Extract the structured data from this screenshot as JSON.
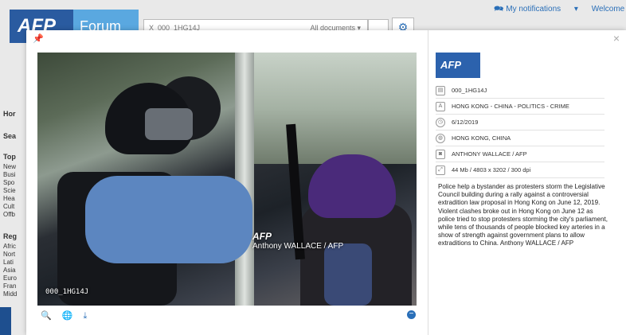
{
  "background": {
    "notifications": "My notifications",
    "welcome": "Welcome",
    "logo_text": "AFP",
    "forum_text": "Forum",
    "search_value": "X_000_1HG14J",
    "search_scope": "All documents",
    "sidebar": {
      "items_top": [
        "Hor",
        "Sea"
      ],
      "topics_header": "Top",
      "topics": [
        "New",
        "Busi",
        "Spo",
        "Scie",
        "Hea",
        "Cult",
        "Offb"
      ],
      "regions_header": "Reg",
      "regions": [
        "Afric",
        "Nort",
        "Lati",
        "Asia",
        "Euro",
        "Fran",
        "Midd"
      ]
    }
  },
  "modal": {
    "photo": {
      "watermark_logo": "AFP",
      "watermark_credit": "Anthony WALLACE / AFP",
      "overlay_id": "000_1HG14J"
    },
    "tools": {
      "zoom_icon": "zoom-in-icon",
      "globe_icon": "globe-icon",
      "download_icon": "download-icon"
    },
    "panel": {
      "logo": "AFP",
      "id": "000_1HG14J",
      "title": "HONG KONG - CHINA - POLITICS - CRIME",
      "date": "6/12/2019",
      "location": "HONG KONG, CHINA",
      "credit": "ANTHONY WALLACE / AFP",
      "file_info": "44 Mb / 4803 x 3202 / 300 dpi",
      "caption": "Police help a bystander as protesters storm the Legislative Council building during a rally against a controversial extradition law proposal in Hong Kong on June 12, 2019. Violent clashes broke out in Hong Kong on June 12 as police tried to stop protesters storming the city's parliament, while tens of thousands of people blocked key arteries in a show of strength against government plans to allow extraditions to China. Anthony WALLACE / AFP"
    }
  }
}
